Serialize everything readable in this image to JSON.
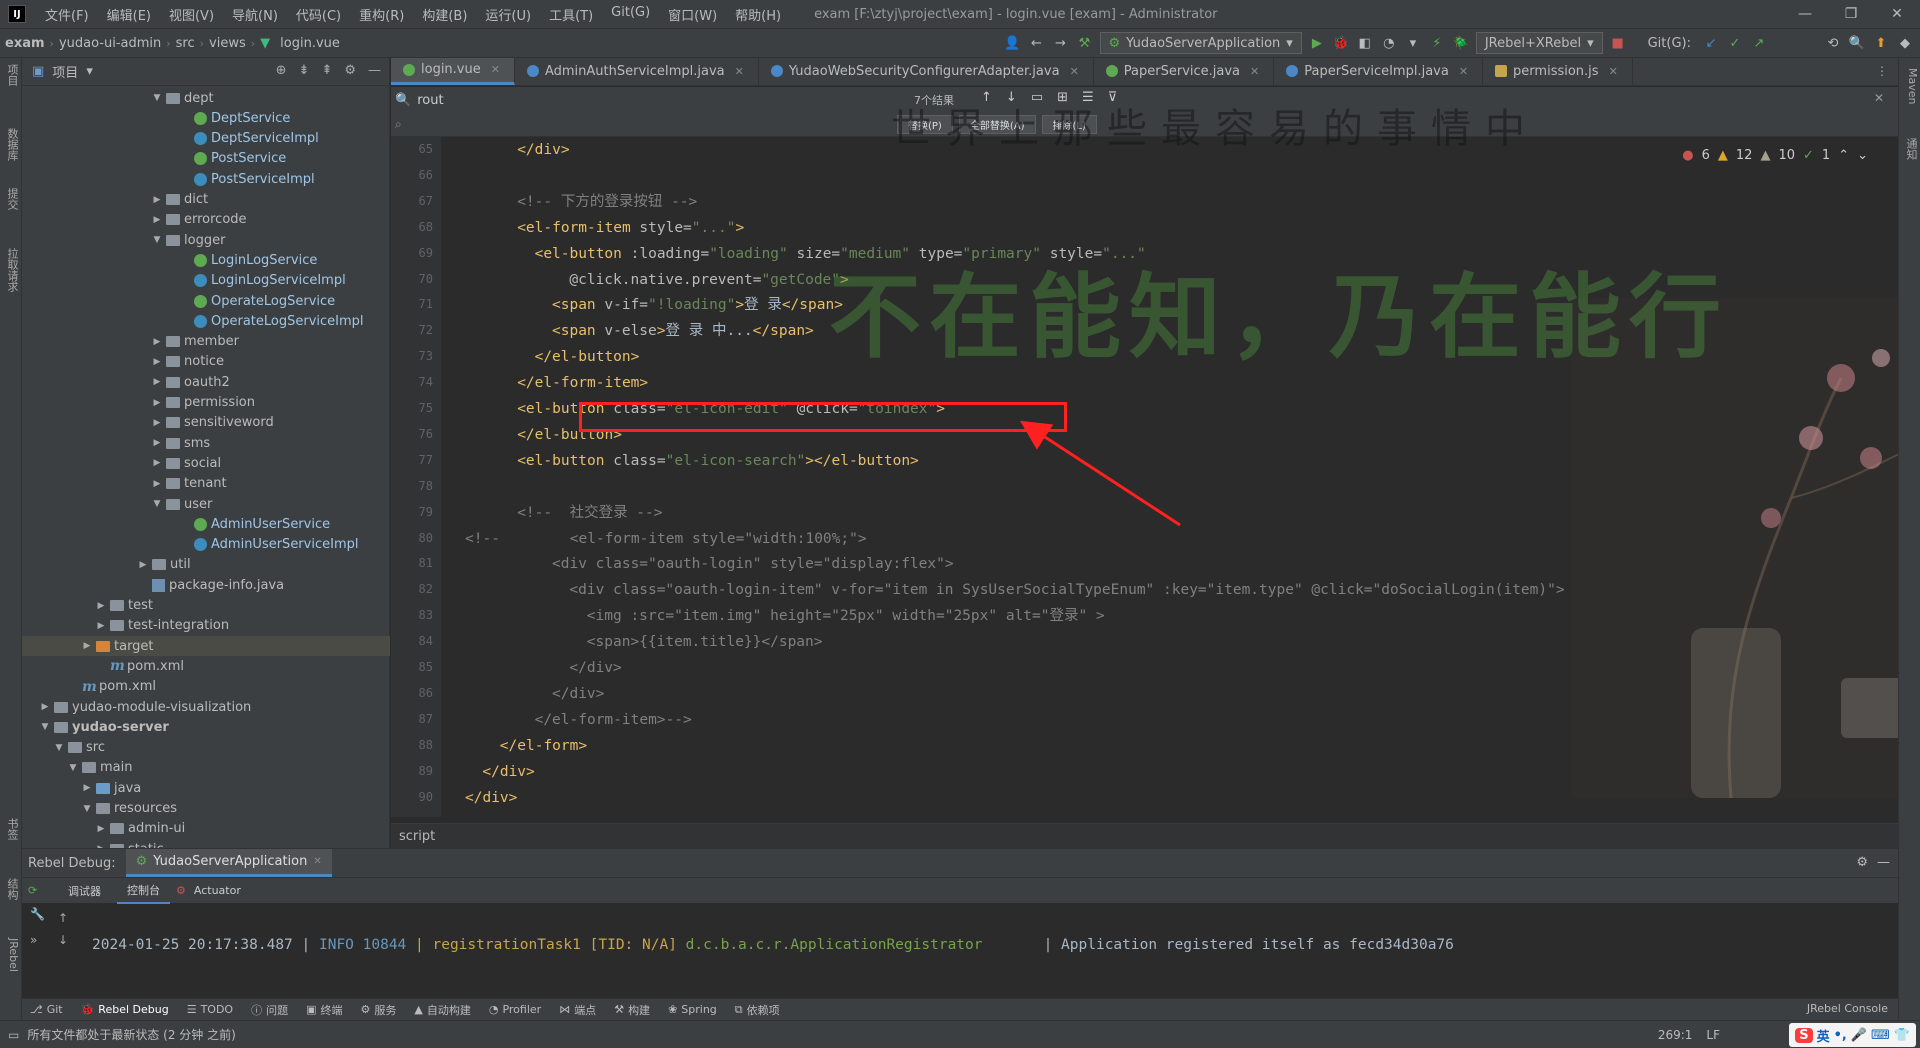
{
  "menubar": {
    "items": [
      "文件(F)",
      "编辑(E)",
      "视图(V)",
      "导航(N)",
      "代码(C)",
      "重构(R)",
      "构建(B)",
      "运行(U)",
      "工具(T)",
      "Git(G)",
      "窗口(W)",
      "帮助(H)"
    ],
    "title": "exam [F:\\ztyj\\project\\exam] - login.vue [exam] - Administrator"
  },
  "navbar": {
    "crumbs": [
      "exam",
      "yudao-ui-admin",
      "src",
      "views",
      "login.vue"
    ],
    "run_config": "YudaoServerApplication",
    "jrebel": "JRebel+XRebel",
    "git_label": "Git(G):"
  },
  "left_strip": [
    "项目",
    "数据库",
    "提交",
    "拉取请求",
    "书签",
    "结构",
    "JRebel"
  ],
  "right_strip": [
    "Maven",
    "通知"
  ],
  "project": {
    "header": "项目",
    "tree": [
      {
        "label": "dept",
        "type": "folder",
        "indent": 9,
        "open": true
      },
      {
        "label": "DeptService",
        "type": "iface",
        "indent": 11
      },
      {
        "label": "DeptServiceImpl",
        "type": "class",
        "indent": 11
      },
      {
        "label": "PostService",
        "type": "iface",
        "indent": 11
      },
      {
        "label": "PostServiceImpl",
        "type": "class",
        "indent": 11
      },
      {
        "label": "dict",
        "type": "folder",
        "indent": 9,
        "open": false
      },
      {
        "label": "errorcode",
        "type": "folder",
        "indent": 9,
        "open": false
      },
      {
        "label": "logger",
        "type": "folder",
        "indent": 9,
        "open": true
      },
      {
        "label": "LoginLogService",
        "type": "iface",
        "indent": 11
      },
      {
        "label": "LoginLogServiceImpl",
        "type": "class",
        "indent": 11
      },
      {
        "label": "OperateLogService",
        "type": "iface",
        "indent": 11
      },
      {
        "label": "OperateLogServiceImpl",
        "type": "class",
        "indent": 11
      },
      {
        "label": "member",
        "type": "folder",
        "indent": 9,
        "open": false
      },
      {
        "label": "notice",
        "type": "folder",
        "indent": 9,
        "open": false
      },
      {
        "label": "oauth2",
        "type": "folder",
        "indent": 9,
        "open": false
      },
      {
        "label": "permission",
        "type": "folder",
        "indent": 9,
        "open": false
      },
      {
        "label": "sensitiveword",
        "type": "folder",
        "indent": 9,
        "open": false
      },
      {
        "label": "sms",
        "type": "folder",
        "indent": 9,
        "open": false
      },
      {
        "label": "social",
        "type": "folder",
        "indent": 9,
        "open": false
      },
      {
        "label": "tenant",
        "type": "folder",
        "indent": 9,
        "open": false
      },
      {
        "label": "user",
        "type": "folder",
        "indent": 9,
        "open": true
      },
      {
        "label": "AdminUserService",
        "type": "iface",
        "indent": 11
      },
      {
        "label": "AdminUserServiceImpl",
        "type": "class",
        "indent": 11
      },
      {
        "label": "util",
        "type": "folder",
        "indent": 8,
        "open": false
      },
      {
        "label": "package-info.java",
        "type": "java",
        "indent": 8
      },
      {
        "label": "test",
        "type": "folder",
        "indent": 5,
        "open": false
      },
      {
        "label": "test-integration",
        "type": "folder",
        "indent": 5,
        "open": false
      },
      {
        "label": "target",
        "type": "folder-orange",
        "indent": 4,
        "open": false,
        "selected": true
      },
      {
        "label": "pom.xml",
        "type": "maven",
        "indent": 5
      },
      {
        "label": "pom.xml",
        "type": "maven",
        "indent": 3
      },
      {
        "label": "yudao-module-visualization",
        "type": "folder",
        "indent": 1,
        "open": false
      },
      {
        "label": "yudao-server",
        "type": "folder",
        "indent": 1,
        "open": true,
        "bold": true
      },
      {
        "label": "src",
        "type": "folder",
        "indent": 2,
        "open": true
      },
      {
        "label": "main",
        "type": "folder",
        "indent": 3,
        "open": true
      },
      {
        "label": "java",
        "type": "folder-blue",
        "indent": 4,
        "open": false
      },
      {
        "label": "resources",
        "type": "folder",
        "indent": 4,
        "open": true
      },
      {
        "label": "admin-ui",
        "type": "folder",
        "indent": 5,
        "open": false
      },
      {
        "label": "static",
        "type": "folder",
        "indent": 5,
        "open": false
      }
    ]
  },
  "tabs": [
    {
      "label": "login.vue",
      "icon": "vue",
      "active": true
    },
    {
      "label": "AdminAuthServiceImpl.java",
      "icon": "class"
    },
    {
      "label": "YudaoWebSecurityConfigurerAdapter.java",
      "icon": "class"
    },
    {
      "label": "PaperService.java",
      "icon": "iface"
    },
    {
      "label": "PaperServiceImpl.java",
      "icon": "class"
    },
    {
      "label": "permission.js",
      "icon": "js"
    }
  ],
  "find": {
    "query": "rout",
    "result_count": "7个结果",
    "replace_buttons": [
      "替换(P)",
      "全部替换(A)",
      "排除(L)"
    ]
  },
  "inspections": {
    "errors": "6",
    "warnings": "12",
    "weak": "10",
    "typos": "1"
  },
  "watermark": "不在能知，乃在能行",
  "watermark_top": "世界上那些最容易的事情中",
  "code_lines": [
    {
      "n": "65",
      "indent": 6,
      "tokens": [
        [
          "tg",
          "</div>"
        ]
      ]
    },
    {
      "n": "66",
      "indent": 0,
      "tokens": []
    },
    {
      "n": "67",
      "indent": 6,
      "tokens": [
        [
          "cm",
          "<!-- 下方的登录按钮 -->"
        ]
      ]
    },
    {
      "n": "68",
      "indent": 6,
      "tokens": [
        [
          "tg",
          "<el-form-item "
        ],
        [
          "at",
          "style="
        ],
        [
          "av",
          "\"...\""
        ],
        [
          "tg",
          ">"
        ]
      ]
    },
    {
      "n": "69",
      "indent": 8,
      "tokens": [
        [
          "tg",
          "<el-button "
        ],
        [
          "at",
          ":loading="
        ],
        [
          "av",
          "\"loading\" "
        ],
        [
          "at",
          "size="
        ],
        [
          "av",
          "\"medium\" "
        ],
        [
          "at",
          "type="
        ],
        [
          "av",
          "\"primary\" "
        ],
        [
          "at",
          "style="
        ],
        [
          "av",
          "\"...\""
        ]
      ]
    },
    {
      "n": "70",
      "indent": 12,
      "tokens": [
        [
          "at",
          "@click.native.prevent="
        ],
        [
          "av",
          "\"getCode\""
        ],
        [
          "tg",
          ">"
        ]
      ]
    },
    {
      "n": "71",
      "indent": 10,
      "tokens": [
        [
          "tg",
          "<span "
        ],
        [
          "at",
          "v-if="
        ],
        [
          "av",
          "\"!loading\""
        ],
        [
          "tg",
          ">"
        ],
        [
          "tx",
          "登 录"
        ],
        [
          "tg",
          "</span>"
        ]
      ]
    },
    {
      "n": "72",
      "indent": 10,
      "tokens": [
        [
          "tg",
          "<span "
        ],
        [
          "at",
          "v-else"
        ],
        [
          "tg",
          ">"
        ],
        [
          "tx",
          "登 录 中..."
        ],
        [
          "tg",
          "</span>"
        ]
      ]
    },
    {
      "n": "73",
      "indent": 8,
      "tokens": [
        [
          "tg",
          "</el-button>"
        ]
      ]
    },
    {
      "n": "74",
      "indent": 6,
      "tokens": [
        [
          "tg",
          "</el-form-item>"
        ]
      ]
    },
    {
      "n": "75",
      "indent": 6,
      "tokens": [
        [
          "tg",
          "<el-button "
        ],
        [
          "at",
          "class="
        ],
        [
          "av",
          "\"el-icon-edit\" "
        ],
        [
          "at",
          "@click="
        ],
        [
          "av",
          "\"toindex\""
        ],
        [
          "tg",
          ">"
        ]
      ]
    },
    {
      "n": "76",
      "indent": 6,
      "tokens": [
        [
          "tg",
          "</el-button>"
        ]
      ]
    },
    {
      "n": "77",
      "indent": 6,
      "tokens": [
        [
          "tg",
          "<el-button "
        ],
        [
          "at",
          "class="
        ],
        [
          "av",
          "\"el-icon-search\""
        ],
        [
          "tg",
          "></el-button>"
        ]
      ]
    },
    {
      "n": "78",
      "indent": 0,
      "tokens": []
    },
    {
      "n": "79",
      "indent": 6,
      "tokens": [
        [
          "cm",
          "<!--  社交登录 -->"
        ]
      ]
    },
    {
      "n": "80",
      "indent": 0,
      "tokens": [
        [
          "cm",
          "<!--        <el-form-item style=\"width:100%;\">"
        ]
      ]
    },
    {
      "n": "81",
      "indent": 10,
      "tokens": [
        [
          "cm",
          "<div class=\"oauth-login\" style=\"display:flex\">"
        ]
      ]
    },
    {
      "n": "82",
      "indent": 12,
      "tokens": [
        [
          "cm",
          "<div class=\"oauth-login-item\" v-for=\"item in SysUserSocialTypeEnum\" :key=\"item.type\" @click=\"doSocialLogin(item)\">"
        ]
      ]
    },
    {
      "n": "83",
      "indent": 14,
      "tokens": [
        [
          "cm",
          "<img :src=\"item.img\" height=\"25px\" width=\"25px\" alt=\"登录\" >"
        ]
      ]
    },
    {
      "n": "84",
      "indent": 14,
      "tokens": [
        [
          "cm",
          "<span>{{item.title}}</span>"
        ]
      ]
    },
    {
      "n": "85",
      "indent": 12,
      "tokens": [
        [
          "cm",
          "</div>"
        ]
      ]
    },
    {
      "n": "86",
      "indent": 10,
      "tokens": [
        [
          "cm",
          "</div>"
        ]
      ]
    },
    {
      "n": "87",
      "indent": 8,
      "tokens": [
        [
          "cm",
          "</el-form-item>-->"
        ]
      ]
    },
    {
      "n": "88",
      "indent": 4,
      "tokens": [
        [
          "tg",
          "</el-form>"
        ]
      ]
    },
    {
      "n": "89",
      "indent": 2,
      "tokens": [
        [
          "tg",
          "</div>"
        ]
      ]
    },
    {
      "n": "90",
      "indent": 0,
      "tokens": [
        [
          "tg",
          "</div>"
        ]
      ]
    }
  ],
  "editor_footer": "script",
  "debug": {
    "label": "Rebel Debug:",
    "tab": "YudaoServerApplication",
    "subtabs": [
      "调试器",
      "控制台",
      "Actuator"
    ],
    "log": {
      "timestamp": "2024-01-25 20:17:38.487 |",
      "level": "INFO 10844",
      "thread": "| registrationTask1 [TID: N/A]",
      "logger": "d.c.b.a.c.r.ApplicationRegistrator",
      "message": "| Application registered itself as fecd34d30a76"
    }
  },
  "bottom_tools": [
    "Git",
    "Rebel Debug",
    "TODO",
    "问题",
    "终端",
    "服务",
    "自动构建",
    "Profiler",
    "端点",
    "构建",
    "Spring",
    "依赖项"
  ],
  "jrebel_console": "JRebel Console",
  "status": {
    "message": "所有文件都处于最新状态 (2 分钟 之前)",
    "position": "269:1",
    "line_sep": "LF",
    "ime": "英"
  }
}
